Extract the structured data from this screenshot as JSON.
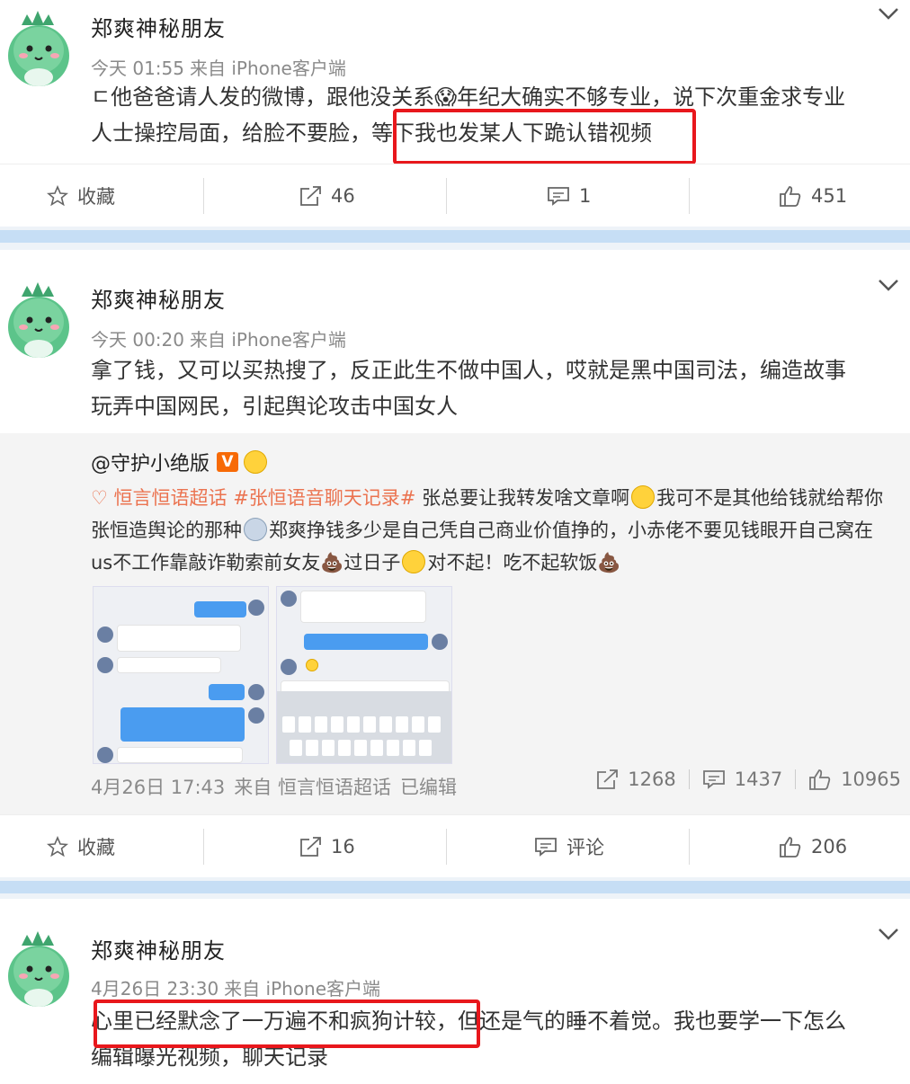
{
  "posts": [
    {
      "author": "郑爽神秘朋友",
      "time": "今天 01:55",
      "source": "来自 iPhone客户端",
      "content_lines": [
        "ㄷ他爸爸请人发的微博，跟他没关系😱年纪大确实不够专业，说下次重金求专业",
        "人士操控局面，给脸不要脸，等下我也发某人下跪认错视频"
      ],
      "actions": {
        "favorite": "收藏",
        "repost": "46",
        "comment": "1",
        "like": "451"
      }
    },
    {
      "author": "郑爽神秘朋友",
      "time": "今天 00:20",
      "source": "来自 iPhone客户端",
      "content_lines": [
        "拿了钱，又可以买热搜了，反正此生不做中国人，哎就是黑中国司法，编造故事",
        "玩弄中国网民，引起舆论攻击中国女人"
      ],
      "repost": {
        "user": "@守护小绝版",
        "badge": "V",
        "text_segments": {
          "topic1": "恒言恒语超话",
          "topic2": "#张恒语音聊天记录#",
          "line1_rest": " 张总要让我转发啥文章啊",
          "line1_tail": "我可不是其他给钱就给帮你",
          "line2_a": "张恒造舆论的那种",
          "line2_b": "郑爽挣钱多少是自己凭自己商业价值挣的，小赤佬不要见钱眼开自己窝在",
          "line3_a": "us不工作靠敲诈勒索前女友💩过日子",
          "line3_b": "对不起！吃不起软饭💩"
        },
        "date": "4月26日 17:43",
        "source": "来自 恒言恒语超话",
        "edited": "已编辑",
        "stats": {
          "repost": "1268",
          "comment": "1437",
          "like": "10965"
        }
      },
      "actions": {
        "favorite": "收藏",
        "repost": "16",
        "comment": "评论",
        "like": "206"
      }
    },
    {
      "author": "郑爽神秘朋友",
      "time": "4月26日 23:30",
      "source": "来自 iPhone客户端",
      "content_lines": [
        "心里已经默念了一万遍不和疯狗计较，但还是气的睡不着觉。我也要学一下怎么",
        "编辑曝光视频，聊天记录"
      ]
    }
  ],
  "colors": {
    "highlight": "#e8171c",
    "topic": "#eb7350",
    "separator": "#c6def5"
  }
}
